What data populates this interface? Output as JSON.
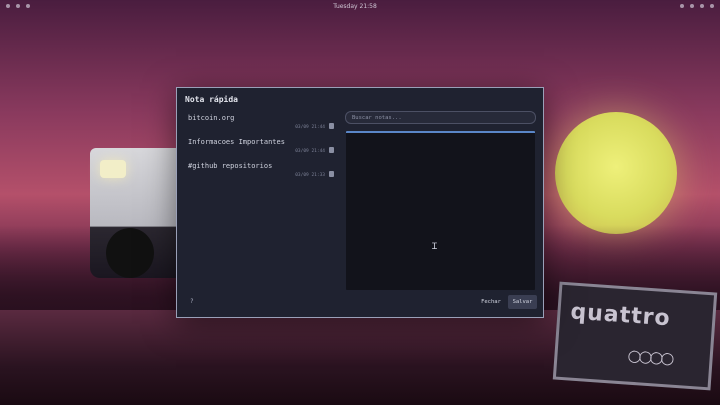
{
  "topbar": {
    "clock": "Tuesday 21:58"
  },
  "dialog": {
    "title": "Nota rápida",
    "notes": [
      {
        "title": "bitcoin.org",
        "date": "03/09 21:44"
      },
      {
        "title": "Informacoes Importantes",
        "date": "03/09 21:44"
      },
      {
        "title": "#github repositorios",
        "date": "03/09 21:33"
      }
    ],
    "search": {
      "placeholder": "Buscar notas..."
    },
    "help": "?",
    "buttons": {
      "close": "Fechar",
      "save": "Salvar"
    }
  },
  "wallpaper": {
    "sign_text": "quattro",
    "sign_rings": "○○○○"
  },
  "colors": {
    "accent": "#5a86c8",
    "dialog_bg": "#1f2230"
  }
}
